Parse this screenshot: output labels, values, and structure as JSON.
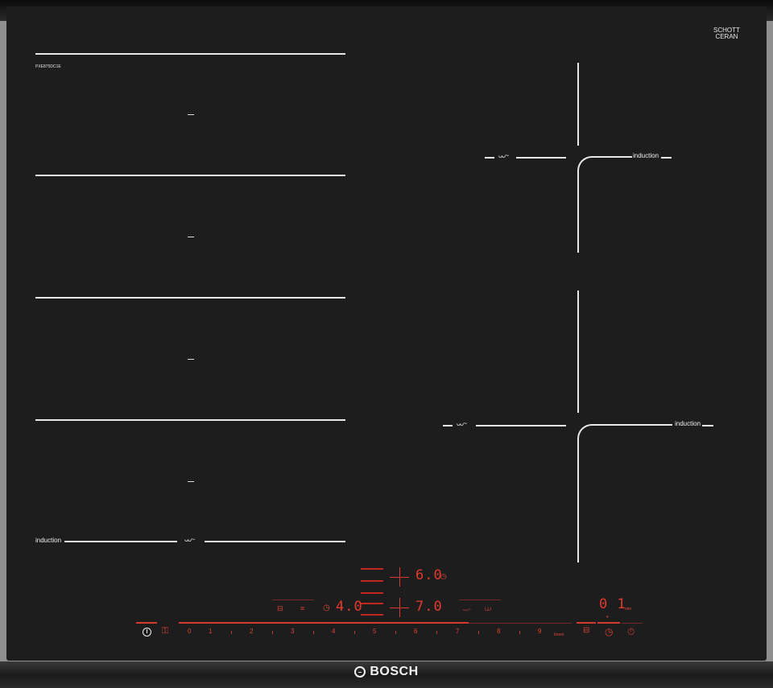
{
  "brand": {
    "name": "BOSCH"
  },
  "glass_logo": {
    "line1": "SCHOTT",
    "line2": "CERAN"
  },
  "model_number": "PXE875DC1E",
  "zone_labels": {
    "left_bottom": "induction",
    "right_top": "induction",
    "right_bottom": "induction"
  },
  "displays": {
    "top_right_level": "6.0",
    "mid_right_level": "7.0",
    "mid_left_level": "4.0",
    "timer": "0 1",
    "timer_unit": "min"
  },
  "slider": {
    "levels": [
      "0",
      "1",
      "2",
      "3",
      "4",
      "5",
      "6",
      "7",
      "8",
      "9"
    ],
    "boost_label": "boost"
  },
  "icons": {
    "power": "power-icon",
    "child_lock": "child-lock-icon",
    "timer": "timer-icon",
    "stopwatch": "stopwatch-icon",
    "frying": "frying-sensor-icon",
    "wave": "flex-zone-icon"
  },
  "colors": {
    "glass": "#1d1d1d",
    "zone_lines": "#e8e8e8",
    "display_red": "#e33a2d"
  }
}
